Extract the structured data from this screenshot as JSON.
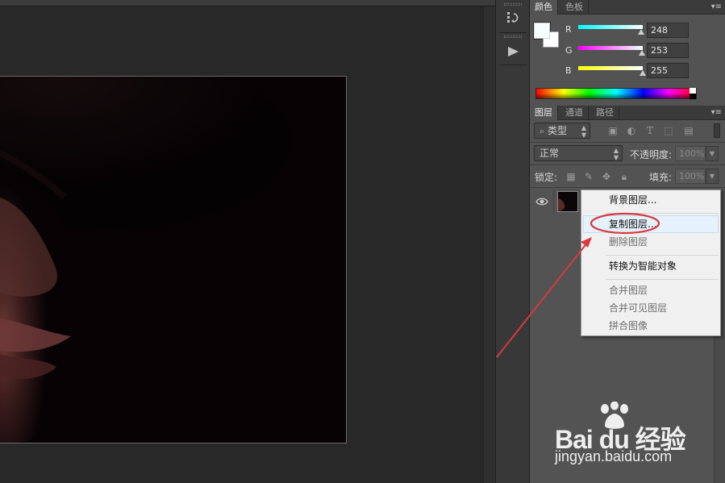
{
  "color_panel": {
    "tabs": [
      {
        "label": "颜色",
        "active": true
      },
      {
        "label": "色板",
        "active": false
      }
    ],
    "foreground_color": "#f8fdff",
    "background_color": "#ffffff",
    "channels": [
      {
        "label": "R",
        "value": "248",
        "fraction": 0.973,
        "gradient": "linear-gradient(to right,#00fdff,#f8fdff)"
      },
      {
        "label": "G",
        "value": "253",
        "fraction": 0.992,
        "gradient": "linear-gradient(to right,#f800ff,#f8ffff)"
      },
      {
        "label": "B",
        "value": "255",
        "fraction": 1.0,
        "gradient": "linear-gradient(to right,#f8fd00,#f8fdff)"
      }
    ],
    "menu_icon": "panel-menu-icon"
  },
  "layers_panel": {
    "tabs": [
      {
        "label": "图层",
        "active": true
      },
      {
        "label": "通道",
        "active": false
      },
      {
        "label": "路径",
        "active": false
      }
    ],
    "filter_label": "类型",
    "blend_mode": "正常",
    "opacity_label": "不透明度:",
    "opacity_value": "100%",
    "lock_label": "锁定:",
    "fill_label": "填充:",
    "fill_value": "100%",
    "filter_icons": [
      "image-filter-icon",
      "adjustment-filter-icon",
      "type-filter-icon",
      "shape-filter-icon",
      "smart-object-filter-icon"
    ],
    "lock_icons": [
      "lock-transparent-icon",
      "lock-image-icon",
      "lock-position-icon",
      "lock-all-icon"
    ]
  },
  "context_menu": {
    "items": [
      {
        "label": "背景图层...",
        "enabled": true
      },
      {
        "label": "复制图层...",
        "enabled": true,
        "highlighted": true
      },
      {
        "label": "删除图层",
        "enabled": false
      },
      {
        "label": "转换为智能对象",
        "enabled": true
      },
      {
        "label": "合并图层",
        "enabled": false
      },
      {
        "label": "合并可见图层",
        "enabled": false
      },
      {
        "label": "拼合图像",
        "enabled": false
      }
    ]
  },
  "annotation": {
    "color": "#d9393f"
  },
  "watermark": {
    "brand": "Bai du 经验",
    "url": "jingyan.baidu.com"
  }
}
